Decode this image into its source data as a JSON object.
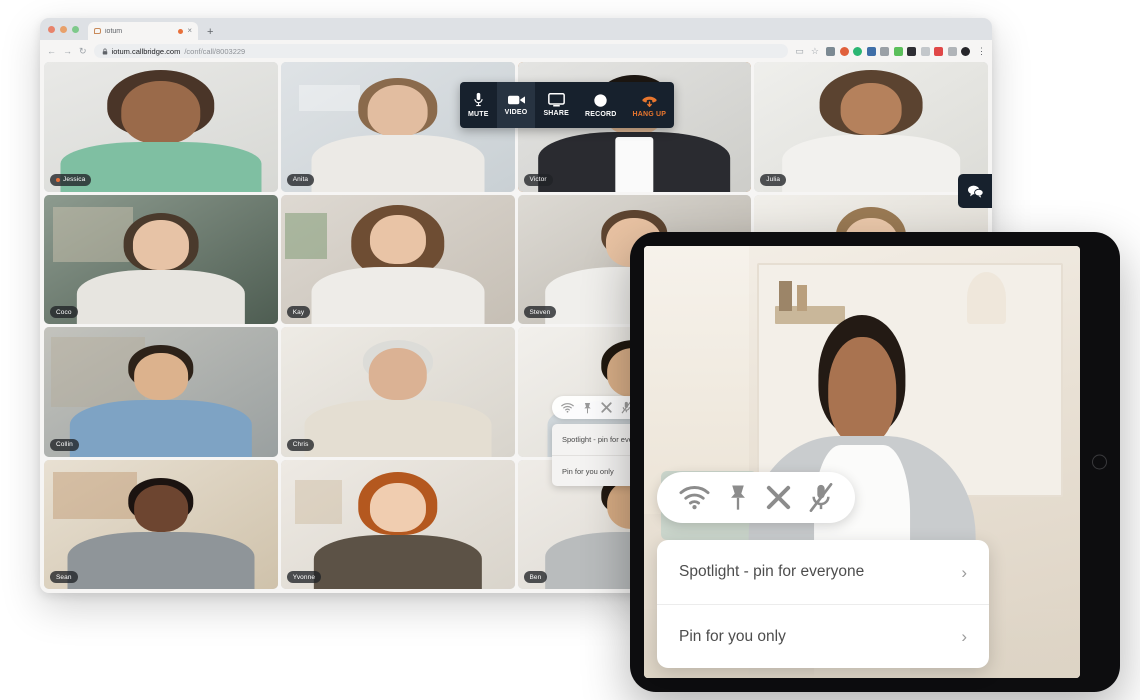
{
  "browser": {
    "tab": {
      "title": "iotum",
      "close_label": "×",
      "recording_dot": true
    },
    "new_tab_label": "+",
    "nav": {
      "back": "←",
      "forward": "→",
      "reload": "↻"
    },
    "url": {
      "lock": "🔒",
      "host": "iotum.callbridge.com",
      "path": "/conf/call/8003229",
      "full": "iotum.callbridge.com/conf/call/8003229"
    },
    "star_icon": "☆",
    "menu_icon": "⋮",
    "extension_colors": [
      "#7c8a93",
      "#b8b0a0",
      "#e0603c",
      "#2bb673",
      "#3f6fa8",
      "#9aa0a6",
      "#5bbf5b",
      "#2f2f35",
      "#c3c7cb",
      "#e04848",
      "#b0b4b8",
      "#26262a"
    ]
  },
  "conference_toolbar": {
    "buttons": [
      {
        "label": "MUTE",
        "icon": "microphone-icon",
        "selected": false
      },
      {
        "label": "VIDEO",
        "icon": "video-camera-icon",
        "selected": true
      },
      {
        "label": "SHARE",
        "icon": "monitor-icon",
        "selected": false
      },
      {
        "label": "RECORD",
        "icon": "record-circle-icon",
        "selected": false
      },
      {
        "label": "HANG UP",
        "icon": "hangup-phone-icon",
        "selected": false
      }
    ],
    "accent_color": "#e8762e",
    "background_color": "#17212d"
  },
  "chat_button": {
    "icon": "chat-bubble-icon"
  },
  "grid": {
    "columns": 4,
    "rows": 4,
    "participants": [
      {
        "name": "Jessica",
        "speaking": true,
        "active": false
      },
      {
        "name": "Anita",
        "speaking": false,
        "active": false
      },
      {
        "name": "Victor",
        "speaking": false,
        "active": true
      },
      {
        "name": "Julia",
        "speaking": false,
        "active": false
      },
      {
        "name": "Coco",
        "speaking": false,
        "active": false
      },
      {
        "name": "Kay",
        "speaking": false,
        "active": false
      },
      {
        "name": "Steven",
        "speaking": false,
        "active": false
      },
      {
        "name": "",
        "speaking": false,
        "active": false
      },
      {
        "name": "Collin",
        "speaking": false,
        "active": false
      },
      {
        "name": "Chris",
        "speaking": false,
        "active": false
      },
      {
        "name": "",
        "speaking": false,
        "active": false
      },
      {
        "name": "",
        "speaking": false,
        "active": false
      },
      {
        "name": "Sean",
        "speaking": false,
        "active": false
      },
      {
        "name": "Yvonne",
        "speaking": false,
        "active": false
      },
      {
        "name": "Ben",
        "speaking": false,
        "active": false
      },
      {
        "name": "",
        "speaking": false,
        "active": false
      }
    ]
  },
  "tile_actions": {
    "icons": [
      {
        "name": "signal-strength-icon",
        "title": "Connection"
      },
      {
        "name": "pin-icon",
        "title": "Pin"
      },
      {
        "name": "close-x-icon",
        "title": "Remove"
      },
      {
        "name": "microphone-muted-icon",
        "title": "Mute"
      }
    ]
  },
  "context_menu": {
    "items": [
      {
        "label": "Spotlight - pin for everyone",
        "chevron": "›"
      },
      {
        "label": "Pin for you only",
        "chevron": "›"
      }
    ]
  },
  "tablet": {
    "home_button": "home-button",
    "featured_speaker": ""
  },
  "theme": {
    "accent": "#e8762e",
    "toolbar_bg": "#17212d",
    "nametag_bg": "rgba(32,34,38,0.78)",
    "menu_text": "#4d4d4d"
  }
}
